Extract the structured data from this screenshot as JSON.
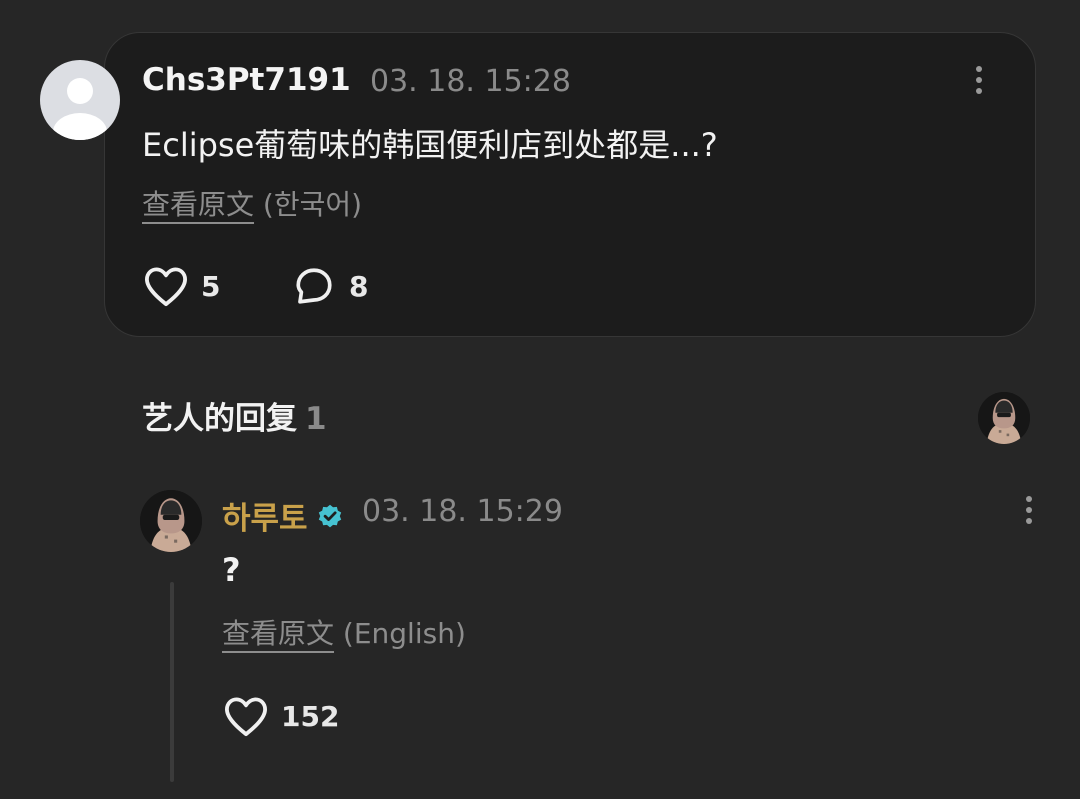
{
  "comment": {
    "author": "Chs3Pt7191",
    "timestamp": "03. 18. 15:28",
    "text": "Eclipse葡萄味的韩国便利店到处都是...?",
    "view_original_label": "查看原文",
    "original_language": "(한국어)",
    "like_count": "5",
    "reply_count": "8",
    "icons": {
      "avatar": "default-user-avatar-icon",
      "more": "more-vertical-icon",
      "like": "heart-outline-icon",
      "reply": "speech-bubble-icon"
    }
  },
  "artist_replies": {
    "title": "艺人的回复",
    "count": "1"
  },
  "reply": {
    "author": "하루토",
    "verified": true,
    "timestamp": "03. 18. 15:29",
    "text": "?",
    "view_original_label": "查看原文",
    "original_language": "(English)",
    "like_count": "152",
    "icons": {
      "verified": "verified-badge-icon",
      "more": "more-vertical-icon",
      "like": "heart-outline-icon"
    }
  },
  "colors": {
    "background": "#262626",
    "card_background": "#1c1c1c",
    "artist_name": "#c9a14a",
    "verified_badge": "#46c2d1",
    "muted_text": "#8a8a8a"
  }
}
